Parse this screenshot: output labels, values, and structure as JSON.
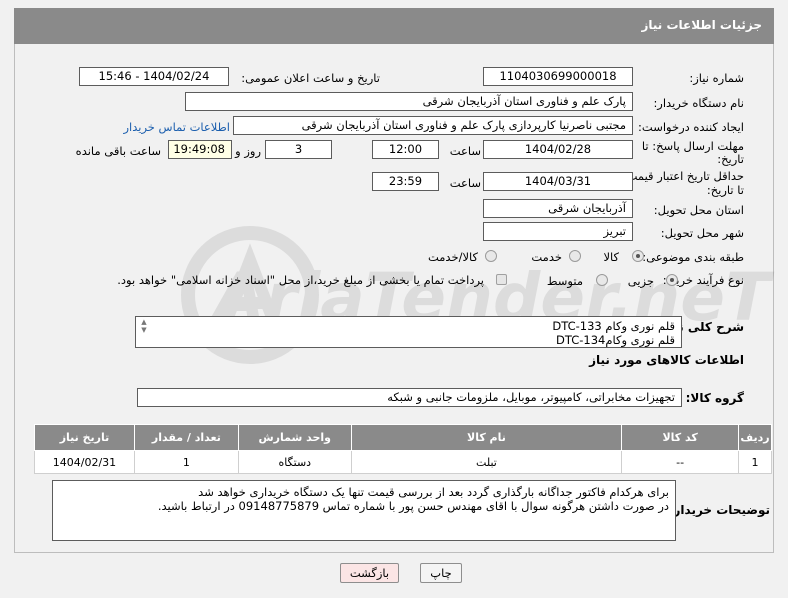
{
  "header": {
    "title": "جزئیات اطلاعات نیاز"
  },
  "form": {
    "need_number": {
      "label": "شماره نیاز:",
      "value": "1104030699000018"
    },
    "announce": {
      "label": "تاریخ و ساعت اعلان عمومی:",
      "value": "1404/02/24 - 15:46"
    },
    "buyer_org": {
      "label": "نام دستگاه خریدار:",
      "value": "پارک علم و فناوری استان آذربایجان شرقی"
    },
    "requester": {
      "label": "ایجاد کننده درخواست:",
      "value": "مجتبی ناصرنیا کارپردازی پارک علم و فناوری استان آذربایجان شرقی",
      "contact_link": "اطلاعات تماس خریدار"
    },
    "reply_deadline": {
      "label_line1": "مهلت ارسال پاسخ: تا",
      "label_line2": "تاریخ:",
      "date": "1404/02/28",
      "time_label": "ساعت",
      "time": "12:00",
      "days": "3",
      "days_label": "روز و",
      "remaining": "19:49:08",
      "remaining_label": "ساعت باقی مانده"
    },
    "price_validity": {
      "label_line1": "حداقل تاریخ اعتبار قیمت:",
      "label_line2": "تا تاریخ:",
      "date": "1404/03/31",
      "time_label": "ساعت",
      "time": "23:59"
    },
    "delivery_province": {
      "label": "استان محل تحویل:",
      "value": "آذربایجان شرقی"
    },
    "delivery_city": {
      "label": "شهر محل تحویل:",
      "value": "تبریز"
    },
    "category": {
      "label": "طبقه بندی موضوعی:",
      "options": [
        "کالا",
        "خدمت",
        "کالا/خدمت"
      ],
      "selected": "کالا"
    },
    "process": {
      "label": "نوع فرآیند خرید :",
      "options": [
        "جزیی",
        "متوسط"
      ],
      "selected": "جزیی",
      "payment_note": "پرداخت تمام یا بخشی از مبلغ خرید،از محل \"اسناد خزانه اسلامی\" خواهد بود."
    },
    "description": {
      "label": "شرح کلی نیاز:",
      "line1": "قلم نوری وکام DTC-133",
      "line2": "قلم نوری وکامDTC-134"
    }
  },
  "goods": {
    "section_title": "اطلاعات کالاهای مورد نیاز",
    "group_label": "گروه کالا:",
    "group_value": "تجهیزات مخابراتی، کامپیوتر، موبایل، ملزومات جانبی و شبکه",
    "columns": [
      "ردیف",
      "کد کالا",
      "نام کالا",
      "واحد شمارش",
      "تعداد / مقدار",
      "تاریخ نیاز"
    ],
    "rows": [
      {
        "row": "1",
        "code": "--",
        "name": "تبلت",
        "unit": "دستگاه",
        "qty": "1",
        "date": "1404/02/31"
      }
    ]
  },
  "buyer_notes": {
    "label": "توضیحات خریدار:",
    "line1": "برای هرکدام فاکتور جداگانه بارگذاری گردد بعد از بررسی قیمت تنها یک دستگاه خریداری خواهد شد",
    "line2": "در صورت داشتن هرگونه سوال با اقای مهندس حسن پور با شماره تماس 09148775879 در ارتباط باشید."
  },
  "buttons": {
    "print": "چاپ",
    "back": "بازگشت"
  },
  "watermark": {
    "text": "AriaTender.neT"
  },
  "colors": {
    "header_bg": "#8a8a8a",
    "link": "#1c5fae",
    "back_button_bg": "#fbe5e5"
  }
}
